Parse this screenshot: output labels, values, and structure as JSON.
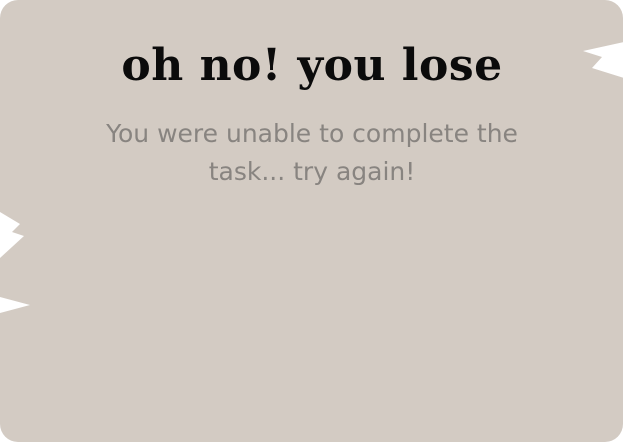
{
  "game_over": {
    "title": "oh no! you lose",
    "message": "You were unable to complete the task... try again!"
  },
  "colors": {
    "panel": "#d3cbc3",
    "title": "#0b0b0b",
    "message": "#888480",
    "tear": "#ffffff"
  }
}
